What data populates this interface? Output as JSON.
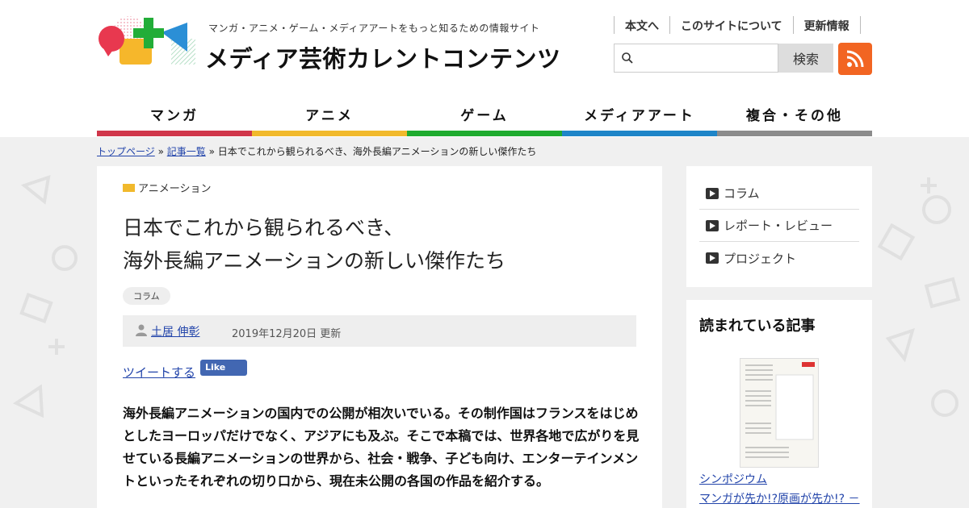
{
  "header": {
    "tagline": "マンガ・アニメ・ゲーム・メディアアートをもっと知るための情報サイト",
    "site_title": "メディア芸術カレントコンテンツ",
    "top_links": [
      "本文へ",
      "このサイトについて",
      "更新情報"
    ],
    "search": {
      "placeholder": "",
      "button_label": "検索",
      "icon": "search-icon"
    },
    "rss_icon": "rss-icon"
  },
  "nav": {
    "items": [
      {
        "label": "マンガ",
        "color": "#d0364a"
      },
      {
        "label": "アニメ",
        "color": "#f1b92c"
      },
      {
        "label": "ゲーム",
        "color": "#1fab2f"
      },
      {
        "label": "メディアアート",
        "color": "#1e85c8"
      },
      {
        "label": "複合・その他",
        "color": "#8c8c8c"
      }
    ]
  },
  "breadcrumb": {
    "home": "トップページ",
    "sep1": " » ",
    "list": "記事一覧",
    "sep2": " » ",
    "current": "日本でこれから観られるべき、海外長編アニメーションの新しい傑作たち"
  },
  "article": {
    "category": "アニメーション",
    "category_color": "#f1b92c",
    "title_line1": "日本でこれから観られるべき、",
    "title_line2": "海外長編アニメーションの新しい傑作たち",
    "tag": "コラム",
    "author": "土居 伸彰",
    "date": "2019年12月20日 更新",
    "tweet": "ツイートする",
    "fb_like": "Like",
    "lead": "海外長編アニメーションの国内での公開が相次いでいる。その制作国はフランスをはじめとしたヨーロッパだけでなく、アジアにも及ぶ。そこで本稿では、世界各地で広がりを見せている長編アニメーションの世界から、社会・戦争、子ども向け、エンターテインメントといったそれぞれの切り口から、現在未公開の各国の作品を紹介する。"
  },
  "sidebar": {
    "categories": [
      "コラム",
      "レポート・レビュー",
      "プロジェクト"
    ],
    "popular_heading": "読まれている記事",
    "popular_item_label": "シンポジウム",
    "popular_item_title": "マンガが先か!?原画が先か!? －",
    "thumb_text": "マンガが先か!?原画が先か!?"
  }
}
